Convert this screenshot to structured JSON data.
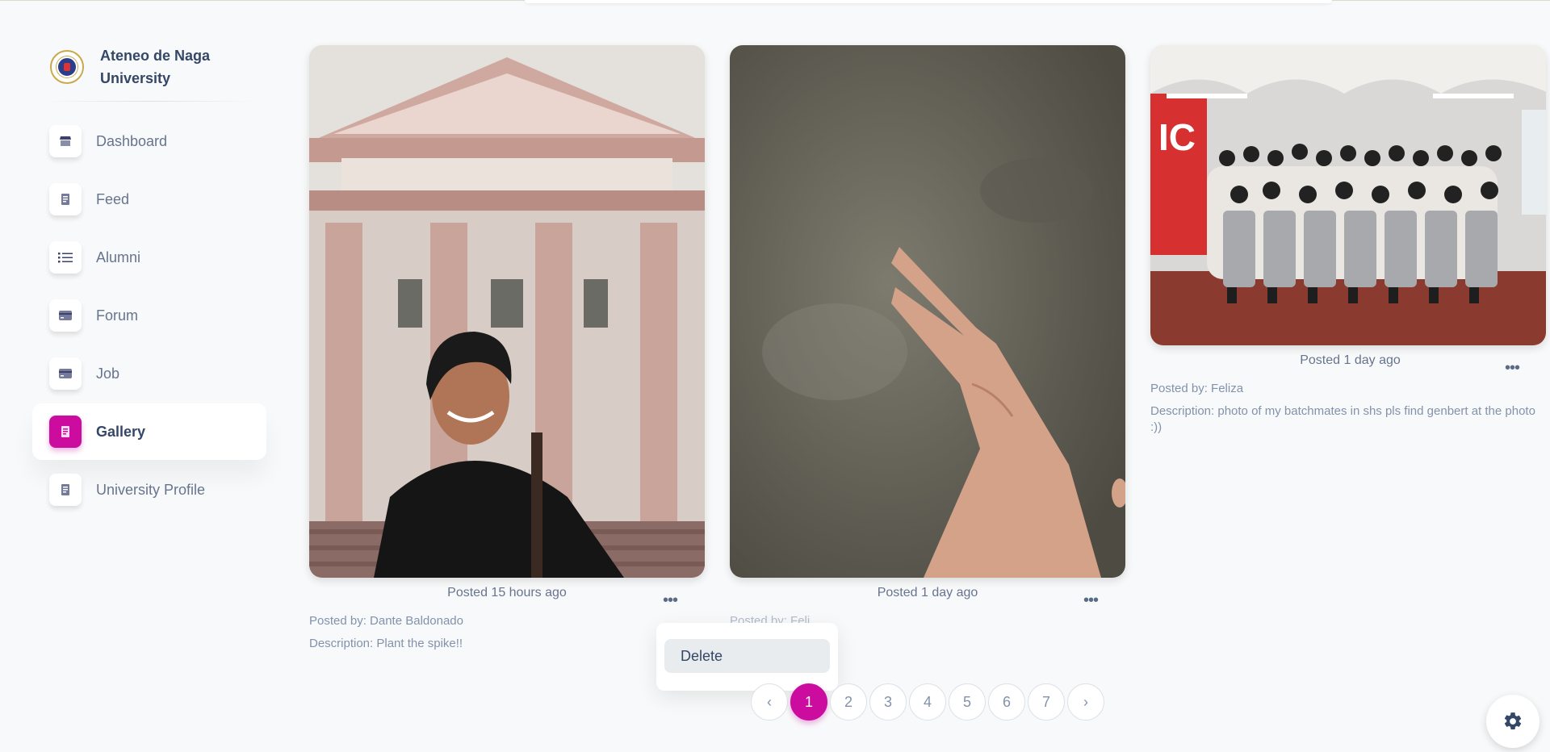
{
  "brand": {
    "name": "Ateneo de Naga University",
    "logo_icon": "university-seal-icon"
  },
  "sidebar": {
    "items": [
      {
        "label": "Dashboard",
        "icon": "shop-icon",
        "active": false
      },
      {
        "label": "Feed",
        "icon": "document-icon",
        "active": false
      },
      {
        "label": "Alumni",
        "icon": "list-icon",
        "active": false
      },
      {
        "label": "Forum",
        "icon": "card-icon",
        "active": false
      },
      {
        "label": "Job",
        "icon": "card-icon",
        "active": false
      },
      {
        "label": "Gallery",
        "icon": "document-icon",
        "active": true
      },
      {
        "label": "University Profile",
        "icon": "document-icon",
        "active": false
      }
    ]
  },
  "gallery": {
    "posts": [
      {
        "posted": "Posted 15 hours ago",
        "posted_by": "Posted by: Dante Baldonado",
        "description": "Description: Plant the spike!!",
        "more_label": "•••",
        "image": "student-in-front-of-ateneo-de-naga-building"
      },
      {
        "posted": "Posted 1 day ago",
        "posted_by": "Posted by: Feli",
        "description": "",
        "more_label": "•••",
        "image": "hand-peace-sign-on-table"
      },
      {
        "posted": "Posted 1 day ago",
        "posted_by": "Posted by: Feliza",
        "description": "Description: photo of my batchmates in shs pls find genbert at the photo :))",
        "more_label": "•••",
        "image": "class-group-photo"
      }
    ]
  },
  "dropdown": {
    "items": [
      "Delete"
    ]
  },
  "pagination": {
    "prev": "‹",
    "next": "›",
    "pages": [
      "1",
      "2",
      "3",
      "4",
      "5",
      "6",
      "7"
    ],
    "current": "1"
  },
  "colors": {
    "accent": "#cb0c9f",
    "text_dark": "#344767",
    "text_muted": "#67748e"
  },
  "settings": {
    "icon": "gear-icon"
  }
}
